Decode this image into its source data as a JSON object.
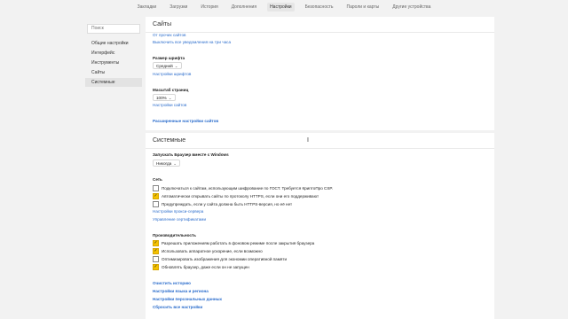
{
  "tabs": [
    "Закладки",
    "Загрузки",
    "История",
    "Дополнения",
    "Настройки",
    "Безопасность",
    "Пароли и карты",
    "Другие устройства"
  ],
  "active_tab": 4,
  "search": {
    "placeholder": "Поиск"
  },
  "sidebar": {
    "items": [
      {
        "label": "Общие настройки"
      },
      {
        "label": "Интерфейс"
      },
      {
        "label": "Инструменты"
      },
      {
        "label": "Сайты"
      },
      {
        "label": "Системные"
      }
    ]
  },
  "sites": {
    "title": "Сайты",
    "link_from_sites": "От прочих сайтов",
    "link_disable_notifications": "Выключить все уведомления на три часа",
    "font_size_label": "Размер шрифта",
    "font_size_value": "Средний",
    "link_font_settings": "Настройки шрифтов",
    "zoom_label": "Масштаб страниц",
    "zoom_value": "100%",
    "link_site_settings": "Настройки сайтов",
    "link_advanced": "Расширенные настройки сайтов"
  },
  "system": {
    "title": "Системные",
    "startup_label": "Запускать Браузер вместе с Windows",
    "startup_value": "Никогда",
    "network_label": "Сеть",
    "network_options": [
      {
        "label": "Подключаться к сайтам, использующим шифрование по ГОСТ. Требуется КриптоПро CSP.",
        "checked": false
      },
      {
        "label": "Автоматически открывать сайты по протоколу HTTPS, если они его поддерживают",
        "checked": true
      },
      {
        "label": "Предупреждать, если у сайта должна быть HTTPS-версия, но её нет",
        "checked": false
      }
    ],
    "link_proxy": "Настройки прокси-сервера",
    "link_certificates": "Управление сертификатами",
    "performance_label": "Производительность",
    "performance_options": [
      {
        "label": "Разрешать приложениям работать в фоновом режиме после закрытия браузера",
        "checked": true
      },
      {
        "label": "Использовать аппаратное ускорение, если возможно",
        "checked": true
      },
      {
        "label": "Оптимизировать изображения для экономии оперативной памяти",
        "checked": false
      },
      {
        "label": "Обновлять браузер, даже если он не запущен",
        "checked": true
      }
    ],
    "link_clear_history": "Очистить историю",
    "link_language": "Настройки языка и региона",
    "link_personal_data": "Настройки персональных данных",
    "link_reset": "Сбросить все настройки"
  },
  "colors": {
    "accent": "#2a6ccc",
    "checkbox_checked": "#f5c200"
  }
}
